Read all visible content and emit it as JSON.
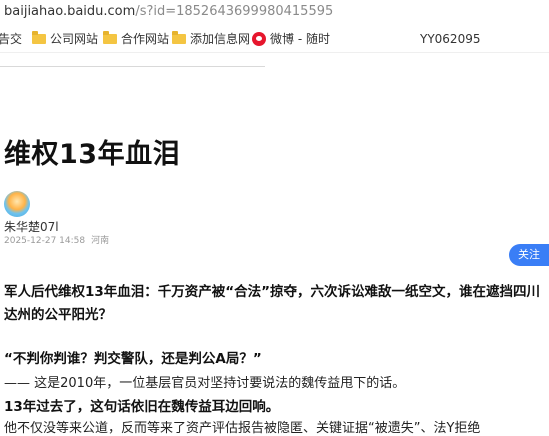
{
  "browser": {
    "url_host": "baijiahao.baidu.com",
    "url_path": "/s?id=1852643699980415595"
  },
  "bookmarks": [
    {
      "label": "告交",
      "icon": "folder-icon"
    },
    {
      "label": "公司网站",
      "icon": "folder-icon"
    },
    {
      "label": "合作网站",
      "icon": "folder-icon"
    },
    {
      "label": "添加信息网",
      "icon": "folder-icon"
    },
    {
      "label": "微博 - 随时",
      "icon": "weibo-icon"
    },
    {
      "label": "YY062095",
      "icon": ""
    }
  ],
  "article": {
    "title": "维权13年血泪",
    "author": "朱华楚07l",
    "date": "2025-12-27 14:58",
    "location": "河南",
    "follow_label": "关注",
    "lead": "军人后代维权13年血泪：千万资产被“合法”掠夺，六次诉讼难敌一纸空文，谁在遮挡四川达州的公平阳光？",
    "quote": "“不判你判谁？判交警队，还是判公A局？”",
    "p1": "—— 这是2010年，一位基层官员对坚持讨要说法的魏传益甩下的话。",
    "p2": "13年过去了，这句话依旧在魏传益耳边回响。",
    "p3": "他不仅没等来公道，反而等来了资产评估报告被隐匿、关键证据“被遗失”、法Y拒绝"
  }
}
